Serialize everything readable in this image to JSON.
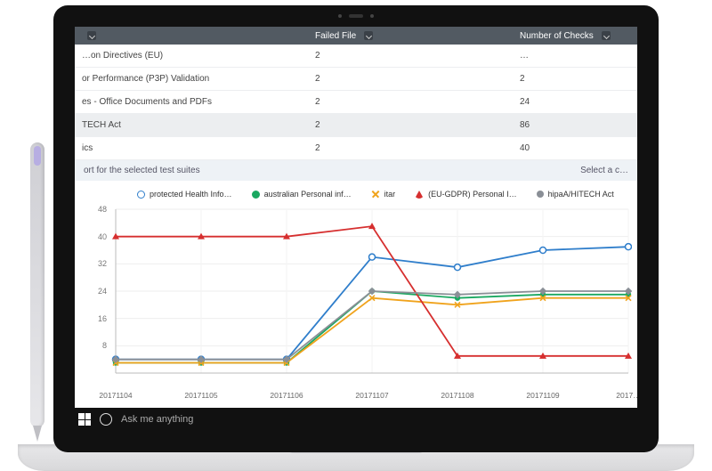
{
  "table": {
    "columns": {
      "name": "",
      "failed": "Failed File",
      "checks": "Number of Checks"
    },
    "rows": [
      {
        "name": "…on Directives (EU)",
        "failed": "2",
        "checks": "…",
        "highlight": false
      },
      {
        "name": "or Performance (P3P) Validation",
        "failed": "2",
        "checks": "2",
        "highlight": false
      },
      {
        "name": "es - Office Documents and PDFs",
        "failed": "2",
        "checks": "24",
        "highlight": false
      },
      {
        "name": "TECH Act",
        "failed": "2",
        "checks": "86",
        "highlight": true
      },
      {
        "name": "ics",
        "failed": "2",
        "checks": "40",
        "highlight": false
      }
    ]
  },
  "subbar": {
    "left": "ort for the selected test suites",
    "right": "Select a c…"
  },
  "legend": [
    {
      "label": "protected Health Info…",
      "color": "#2f7ecb",
      "marker": "open"
    },
    {
      "label": "australian Personal inf…",
      "color": "#1aa861",
      "marker": "fill"
    },
    {
      "label": "itar",
      "color": "#f0a31c",
      "marker": "x"
    },
    {
      "label": "(EU-GDPR) Personal I…",
      "color": "#d62f2f",
      "marker": "tri"
    },
    {
      "label": "hipaA/HITECH Act",
      "color": "#8a8f96",
      "marker": "dia"
    }
  ],
  "chart_data": {
    "type": "line",
    "title": "",
    "xlabel": "",
    "ylabel": "",
    "ylim": [
      0,
      48
    ],
    "yticks": [
      48,
      40,
      32,
      24,
      16,
      8,
      0
    ],
    "x": [
      "20171104",
      "20171105",
      "20171106",
      "20171107",
      "20171108",
      "20171109",
      "2017…"
    ],
    "series": [
      {
        "name": "protected Health Info…",
        "color": "#2f7ecb",
        "values": [
          4,
          4,
          4,
          34,
          31,
          36,
          37
        ]
      },
      {
        "name": "australian Personal inf…",
        "color": "#1aa861",
        "values": [
          3,
          3,
          3,
          24,
          22,
          23,
          23
        ]
      },
      {
        "name": "itar",
        "color": "#f0a31c",
        "values": [
          3,
          3,
          3,
          22,
          20,
          22,
          22
        ]
      },
      {
        "name": "(EU-GDPR) Personal I…",
        "color": "#d62f2f",
        "values": [
          40,
          40,
          40,
          43,
          5,
          5,
          5
        ]
      },
      {
        "name": "hipaA/HITECH Act",
        "color": "#8a8f96",
        "values": [
          4,
          4,
          4,
          24,
          23,
          24,
          24
        ]
      }
    ]
  },
  "taskbar": {
    "search_placeholder": "Ask me anything"
  }
}
